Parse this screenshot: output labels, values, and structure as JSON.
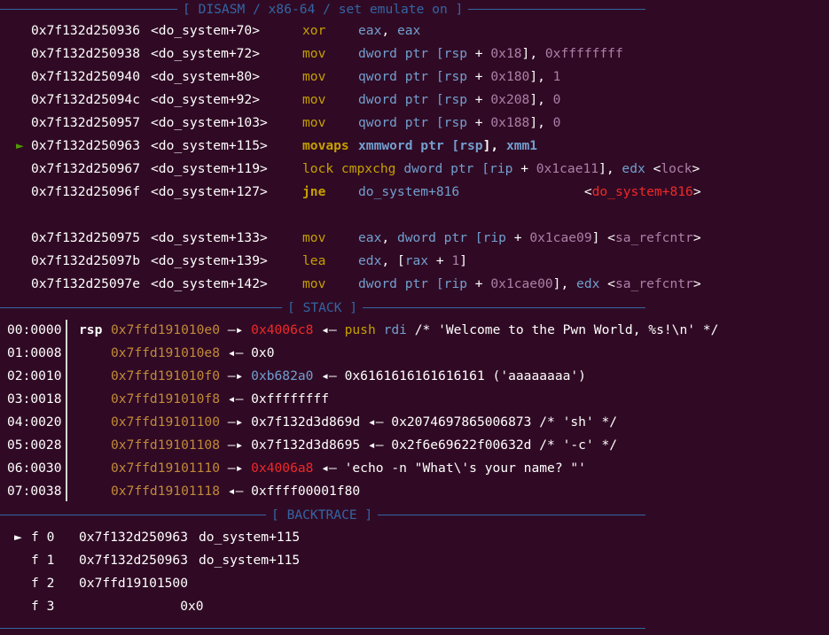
{
  "headers": {
    "disasm": "[ DISASM / x86-64 / set emulate on ]",
    "stack": "[ STACK ]",
    "backtrace": "[ BACKTRACE ]"
  },
  "disasm": {
    "current_marker": "►",
    "rows": [
      {
        "addr": "0x7f132d250936",
        "sym": "<do_system+70>",
        "mnem": "xor",
        "ops": [
          {
            "t": "eax",
            "c": "blue"
          },
          {
            "t": ", ",
            "c": "white"
          },
          {
            "t": "eax",
            "c": "blue"
          }
        ]
      },
      {
        "addr": "0x7f132d250938",
        "sym": "<do_system+72>",
        "mnem": "mov",
        "ops": [
          {
            "t": "dword ptr [",
            "c": "blue"
          },
          {
            "t": "rsp",
            "c": "blue"
          },
          {
            "t": " + ",
            "c": "white"
          },
          {
            "t": "0x18",
            "c": "purple"
          },
          {
            "t": "], ",
            "c": "white"
          },
          {
            "t": "0xffffffff",
            "c": "purple"
          }
        ]
      },
      {
        "addr": "0x7f132d250940",
        "sym": "<do_system+80>",
        "mnem": "mov",
        "ops": [
          {
            "t": "qword ptr [",
            "c": "blue"
          },
          {
            "t": "rsp",
            "c": "blue"
          },
          {
            "t": " + ",
            "c": "white"
          },
          {
            "t": "0x180",
            "c": "purple"
          },
          {
            "t": "], ",
            "c": "white"
          },
          {
            "t": "1",
            "c": "purple"
          }
        ]
      },
      {
        "addr": "0x7f132d25094c",
        "sym": "<do_system+92>",
        "mnem": "mov",
        "ops": [
          {
            "t": "dword ptr [",
            "c": "blue"
          },
          {
            "t": "rsp",
            "c": "blue"
          },
          {
            "t": " + ",
            "c": "white"
          },
          {
            "t": "0x208",
            "c": "purple"
          },
          {
            "t": "], ",
            "c": "white"
          },
          {
            "t": "0",
            "c": "purple"
          }
        ]
      },
      {
        "addr": "0x7f132d250957",
        "sym": "<do_system+103>",
        "mnem": "mov",
        "ops": [
          {
            "t": "qword ptr [",
            "c": "blue"
          },
          {
            "t": "rsp",
            "c": "blue"
          },
          {
            "t": " + ",
            "c": "white"
          },
          {
            "t": "0x188",
            "c": "purple"
          },
          {
            "t": "], ",
            "c": "white"
          },
          {
            "t": "0",
            "c": "purple"
          }
        ]
      },
      {
        "addr": "0x7f132d250963",
        "sym": "<do_system+115>",
        "mnem": "movaps",
        "current": true,
        "ops": [
          {
            "t": "xmmword ptr [",
            "c": "blue"
          },
          {
            "t": "rsp",
            "c": "blue"
          },
          {
            "t": "], ",
            "c": "white"
          },
          {
            "t": "xmm1",
            "c": "blue"
          }
        ]
      },
      {
        "addr": "0x7f132d250967",
        "sym": "<do_system+119>",
        "mnem": "lock cmpxchg",
        "ops": [
          {
            "t": "dword ptr [",
            "c": "blue"
          },
          {
            "t": "rip",
            "c": "blue"
          },
          {
            "t": " + ",
            "c": "white"
          },
          {
            "t": "0x1cae11",
            "c": "purple"
          },
          {
            "t": "], ",
            "c": "white"
          },
          {
            "t": "edx",
            "c": "blue"
          },
          {
            "t": " <",
            "c": "white"
          },
          {
            "t": "lock",
            "c": "purple"
          },
          {
            "t": ">",
            "c": "white"
          }
        ]
      },
      {
        "addr": "0x7f132d25096f",
        "sym": "<do_system+127>",
        "mnem": "jne",
        "mnemBold": true,
        "ops": [
          {
            "t": "do_system+816",
            "c": "blue"
          },
          {
            "t": "                <",
            "c": "white"
          },
          {
            "t": "do_system+816",
            "c": "red"
          },
          {
            "t": ">",
            "c": "white"
          }
        ]
      },
      {
        "addr": "0x7f132d250975",
        "sym": "<do_system+133>",
        "mnem": "mov",
        "ops": [
          {
            "t": "eax",
            "c": "blue"
          },
          {
            "t": ", ",
            "c": "white"
          },
          {
            "t": "dword ptr [",
            "c": "blue"
          },
          {
            "t": "rip",
            "c": "blue"
          },
          {
            "t": " + ",
            "c": "white"
          },
          {
            "t": "0x1cae09",
            "c": "purple"
          },
          {
            "t": "] <",
            "c": "white"
          },
          {
            "t": "sa_refcntr",
            "c": "purple"
          },
          {
            "t": ">",
            "c": "white"
          }
        ]
      },
      {
        "addr": "0x7f132d25097b",
        "sym": "<do_system+139>",
        "mnem": "lea",
        "ops": [
          {
            "t": "edx",
            "c": "blue"
          },
          {
            "t": ", [",
            "c": "white"
          },
          {
            "t": "rax",
            "c": "blue"
          },
          {
            "t": " + ",
            "c": "white"
          },
          {
            "t": "1",
            "c": "purple"
          },
          {
            "t": "]",
            "c": "white"
          }
        ]
      },
      {
        "addr": "0x7f132d25097e",
        "sym": "<do_system+142>",
        "mnem": "mov",
        "ops": [
          {
            "t": "dword ptr [",
            "c": "blue"
          },
          {
            "t": "rip",
            "c": "blue"
          },
          {
            "t": " + ",
            "c": "white"
          },
          {
            "t": "0x1cae00",
            "c": "purple"
          },
          {
            "t": "], ",
            "c": "white"
          },
          {
            "t": "edx",
            "c": "blue"
          },
          {
            "t": " <",
            "c": "white"
          },
          {
            "t": "sa_refcntr",
            "c": "purple"
          },
          {
            "t": ">",
            "c": "white"
          }
        ]
      }
    ]
  },
  "stack": {
    "rows": [
      {
        "idx": "00:0000",
        "reg": "rsp",
        "addr": "0x7ffd191010e0",
        "rest": [
          {
            "t": " —▸ ",
            "c": "white"
          },
          {
            "t": "0x4006c8",
            "c": "red"
          },
          {
            "t": " ◂— ",
            "c": "white"
          },
          {
            "t": "push",
            "c": "yellow"
          },
          {
            "t": " ",
            "c": "white"
          },
          {
            "t": "rdi",
            "c": "blue"
          },
          {
            "t": " /* 'Welcome to the Pwn World, %s!\\n' */",
            "c": "white"
          }
        ]
      },
      {
        "idx": "01:0008",
        "reg": "",
        "addr": "0x7ffd191010e8",
        "rest": [
          {
            "t": " ◂— 0x0",
            "c": "white"
          }
        ]
      },
      {
        "idx": "02:0010",
        "reg": "",
        "addr": "0x7ffd191010f0",
        "rest": [
          {
            "t": " —▸ ",
            "c": "white"
          },
          {
            "t": "0xb682a0",
            "c": "blue"
          },
          {
            "t": " ◂— 0x6161616161616161 ('aaaaaaaa')",
            "c": "white"
          }
        ]
      },
      {
        "idx": "03:0018",
        "reg": "",
        "addr": "0x7ffd191010f8",
        "rest": [
          {
            "t": " ◂— 0xffffffff",
            "c": "white"
          }
        ]
      },
      {
        "idx": "04:0020",
        "reg": "",
        "addr": "0x7ffd19101100",
        "rest": [
          {
            "t": " —▸ 0x7f132d3d869d ◂— 0x2074697865006873 /* 'sh' */",
            "c": "white"
          }
        ]
      },
      {
        "idx": "05:0028",
        "reg": "",
        "addr": "0x7ffd19101108",
        "rest": [
          {
            "t": " —▸ 0x7f132d3d8695 ◂— 0x2f6e69622f00632d /* '-c' */",
            "c": "white"
          }
        ]
      },
      {
        "idx": "06:0030",
        "reg": "",
        "addr": "0x7ffd19101110",
        "rest": [
          {
            "t": " —▸ ",
            "c": "white"
          },
          {
            "t": "0x4006a8",
            "c": "red"
          },
          {
            "t": " ◂— 'echo -n \"What\\'s your name? \"'",
            "c": "white"
          }
        ]
      },
      {
        "idx": "07:0038",
        "reg": "",
        "addr": "0x7ffd19101118",
        "rest": [
          {
            "t": " ◂— 0xffff00001f80",
            "c": "white"
          }
        ]
      }
    ]
  },
  "backtrace": {
    "marker": "►",
    "rows": [
      {
        "frame": "f 0",
        "addr": "0x7f132d250963",
        "sym": "do_system+115"
      },
      {
        "frame": "f 1",
        "addr": "0x7f132d250963",
        "sym": "do_system+115"
      },
      {
        "frame": "f 2",
        "addr": "0x7ffd19101500",
        "sym": ""
      },
      {
        "frame": "f 3",
        "addr": "             0x0",
        "sym": ""
      }
    ]
  },
  "colors": {
    "background": "#300a24",
    "separator": "#3465a4",
    "current": "#4e9a06",
    "mnemonic": "#c4a000",
    "register": "#729fcf",
    "number": "#ad7fa8",
    "symbol_red": "#ef2929",
    "stack_addr": "#c18a3a"
  }
}
